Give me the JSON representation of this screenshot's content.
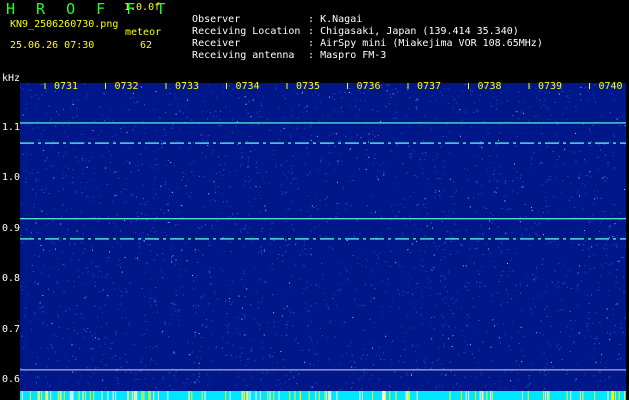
{
  "header": {
    "app_title": "H R O F F T",
    "version": "1.0.0f",
    "filename": "KN9_2506260730.png",
    "datetime": "25.06.26 07:30",
    "meteor_label": "meteor",
    "meteor_count": "62",
    "info": [
      {
        "key": "Observer",
        "value": ": K.Nagai"
      },
      {
        "key": "Receiving Location",
        "value": ": Chigasaki, Japan (139.414 35.340)"
      },
      {
        "key": "Receiver",
        "value": ": AirSpy mini (Miakejima VOR 108.65MHz)"
      },
      {
        "key": "Receiving antenna",
        "value": ": Maspro FM-3"
      }
    ]
  },
  "colors": {
    "background": "#000000",
    "plot_background": "#00178a",
    "trace": "#4ee0d0",
    "noise": "#2f6aff",
    "bottom_band": "#00e6ff",
    "tick_yellow": "#ffff00"
  },
  "chart_data": {
    "type": "heatmap",
    "ylabel": "kHz",
    "ylim": [
      0.6,
      1.15
    ],
    "yticks": [
      "1.1",
      "1.0",
      "0.9",
      "0.8",
      "0.7",
      "0.6"
    ],
    "ytick_values": [
      1.1,
      1.0,
      0.9,
      0.8,
      0.7,
      0.6
    ],
    "xticks": [
      "0731",
      "0732",
      "0733",
      "0734",
      "0735",
      "0736",
      "0737",
      "0738",
      "0739",
      "0740"
    ],
    "xrange_minutes": [
      0,
      10
    ],
    "traces": [
      {
        "freq_khz": 1.11,
        "style": "solid"
      },
      {
        "freq_khz": 1.07,
        "style": "dashed"
      },
      {
        "freq_khz": 0.92,
        "style": "solid"
      },
      {
        "freq_khz": 0.88,
        "style": "dashed"
      },
      {
        "freq_khz": 0.62,
        "style": "solid"
      }
    ]
  }
}
